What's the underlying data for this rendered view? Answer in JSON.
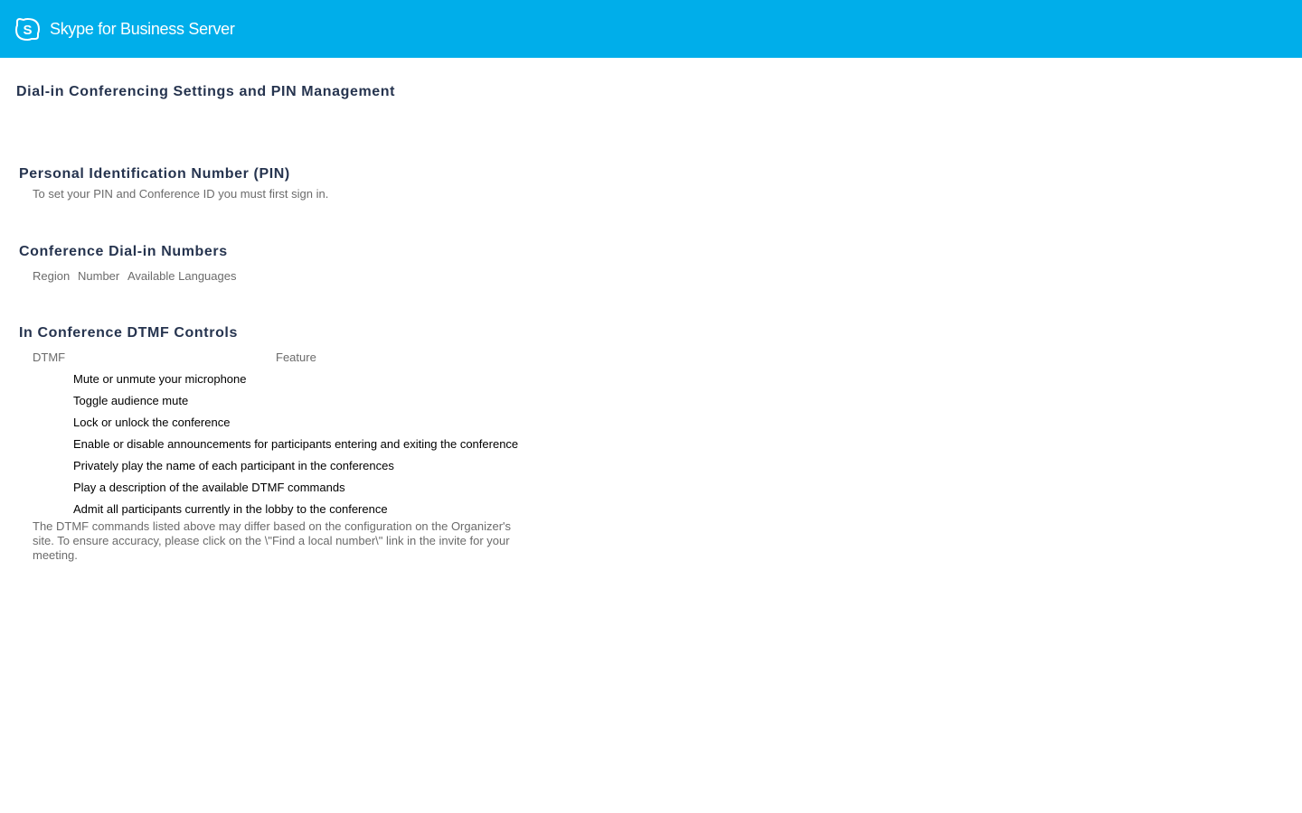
{
  "header": {
    "brand": "Skype for Business Server"
  },
  "page_title": "Dial-in Conferencing Settings and PIN Management",
  "pin": {
    "heading": "Personal Identification Number (PIN)",
    "message": "To set your PIN and Conference ID you must first sign in."
  },
  "dialin": {
    "heading": "Conference Dial-in Numbers",
    "columns": [
      "Region",
      "Number",
      "Available Languages"
    ]
  },
  "dtmf": {
    "heading": "In Conference DTMF Controls",
    "col_dtmf": "DTMF",
    "col_feature": "Feature",
    "rows": [
      "Mute or unmute your microphone",
      "Toggle audience mute",
      "Lock or unlock the conference",
      "Enable or disable announcements for participants entering and exiting the conference",
      "Privately play the name of each participant in the conferences",
      "Play a description of the available DTMF commands",
      "Admit all participants currently in the lobby to the conference"
    ],
    "note": "The DTMF commands listed above may differ based on the configuration on the Organizer's site. To ensure accuracy, please click on the \\\"Find a local number\\\" link in the invite for your meeting."
  }
}
